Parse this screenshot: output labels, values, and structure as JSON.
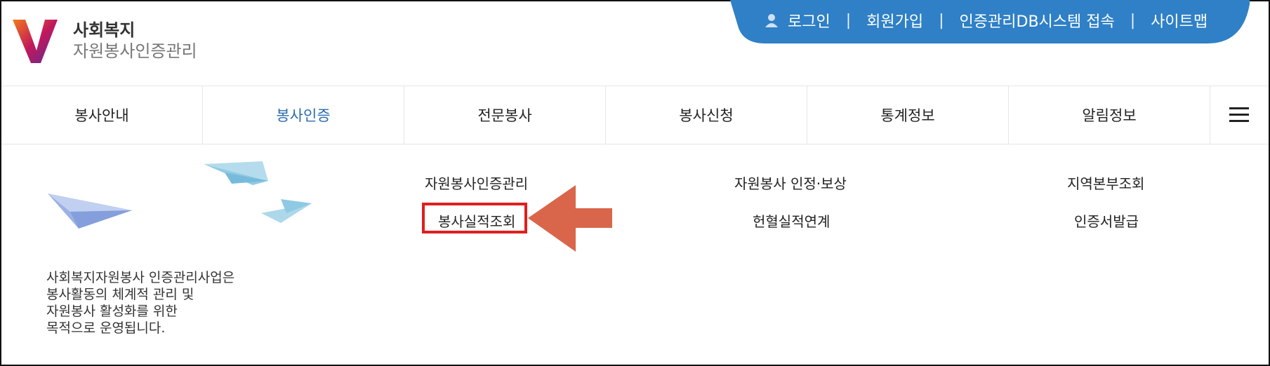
{
  "logo": {
    "line1": "사회복지",
    "line2": "자원봉사인증관리",
    "mark_colors": [
      "#f27a1a",
      "#c2185b",
      "#5e2b97"
    ]
  },
  "topbar": {
    "color": "#2f80c6",
    "items": [
      "로그인",
      "회원가입",
      "인증관리DB시스템 접속",
      "사이트맵"
    ],
    "separator": "|",
    "icon": "user-icon"
  },
  "nav": {
    "items": [
      "봉사안내",
      "봉사인증",
      "전문봉사",
      "봉사신청",
      "통계정보",
      "알림정보"
    ],
    "active": "봉사인증",
    "menu_icon": "hamburger-menu-icon"
  },
  "submenu": {
    "description": [
      "사회복지자원봉사 인증관리사업은",
      "봉사활동의 체계적 관리 및",
      "자원봉사 활성화를 위한",
      "목적으로 운영됩니다."
    ],
    "col1": [
      "자원봉사인증관리",
      "봉사실적조회"
    ],
    "col2": [
      "자원봉사 인정·보상",
      "헌혈실적연계"
    ],
    "col3": [
      "지역본부조회",
      "인증서발급"
    ],
    "highlighted": "봉사실적조회",
    "highlight_color": "#e11e1e",
    "arrow_color": "#d9664a"
  }
}
